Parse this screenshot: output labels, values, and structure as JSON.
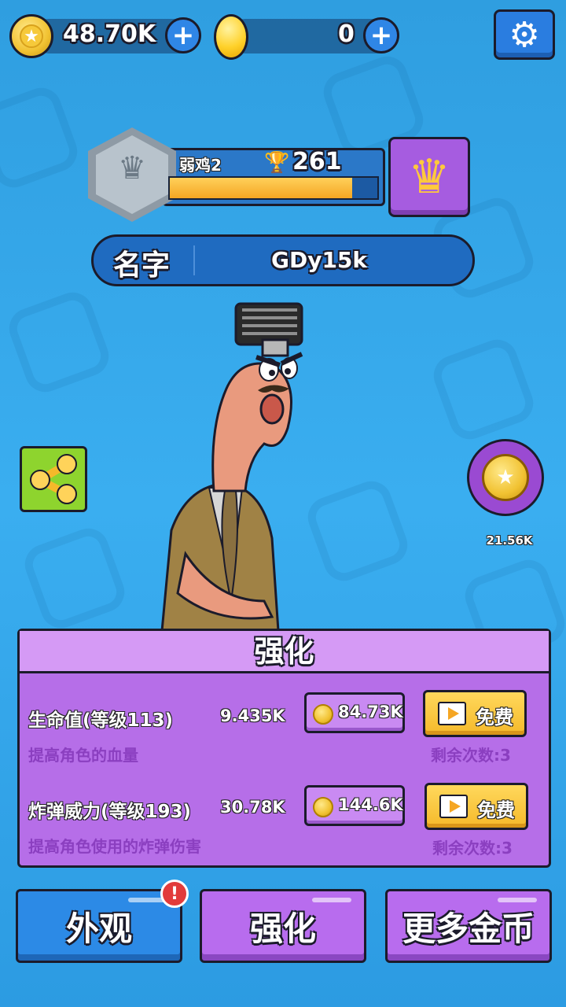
{
  "topbar": {
    "coins": "48.70K",
    "gems": "0",
    "coin_icon": "star-coin-icon",
    "gem_icon": "gold-egg-icon",
    "plus_icon": "plus-icon",
    "settings_icon": "gear-icon"
  },
  "rank": {
    "name": "弱鸡2",
    "trophies": "261",
    "progress": 0.88,
    "badge_icon": "silver-crown-badge-icon",
    "vip_icon": "gold-crown-icon"
  },
  "player": {
    "name_label": "名字",
    "name_value": "GDy15k"
  },
  "side": {
    "share_icon": "share-icon",
    "bonus_coins": "21.56K"
  },
  "upgrade_panel": {
    "title": "强化",
    "items": [
      {
        "name": "生命值(等级113)",
        "value": "9.435K",
        "desc": "提高角色的血量",
        "cost": "84.73K",
        "free_label": "免费",
        "remaining": "剩余次数:3"
      },
      {
        "name": "炸弹威力(等级193)",
        "value": "30.78K",
        "desc": "提高角色使用的炸弹伤害",
        "cost": "144.6K",
        "free_label": "免费",
        "remaining": "剩余次数:3"
      }
    ]
  },
  "nav": {
    "appearance": "外观",
    "upgrade": "强化",
    "more_coins": "更多金币",
    "badge": "!"
  },
  "colors": {
    "background": "#3aaef0",
    "panel": "#b66ee8",
    "blue_button": "#2c8ae6",
    "purple_button": "#b86cee",
    "yellow_button": "#f5b92a"
  }
}
